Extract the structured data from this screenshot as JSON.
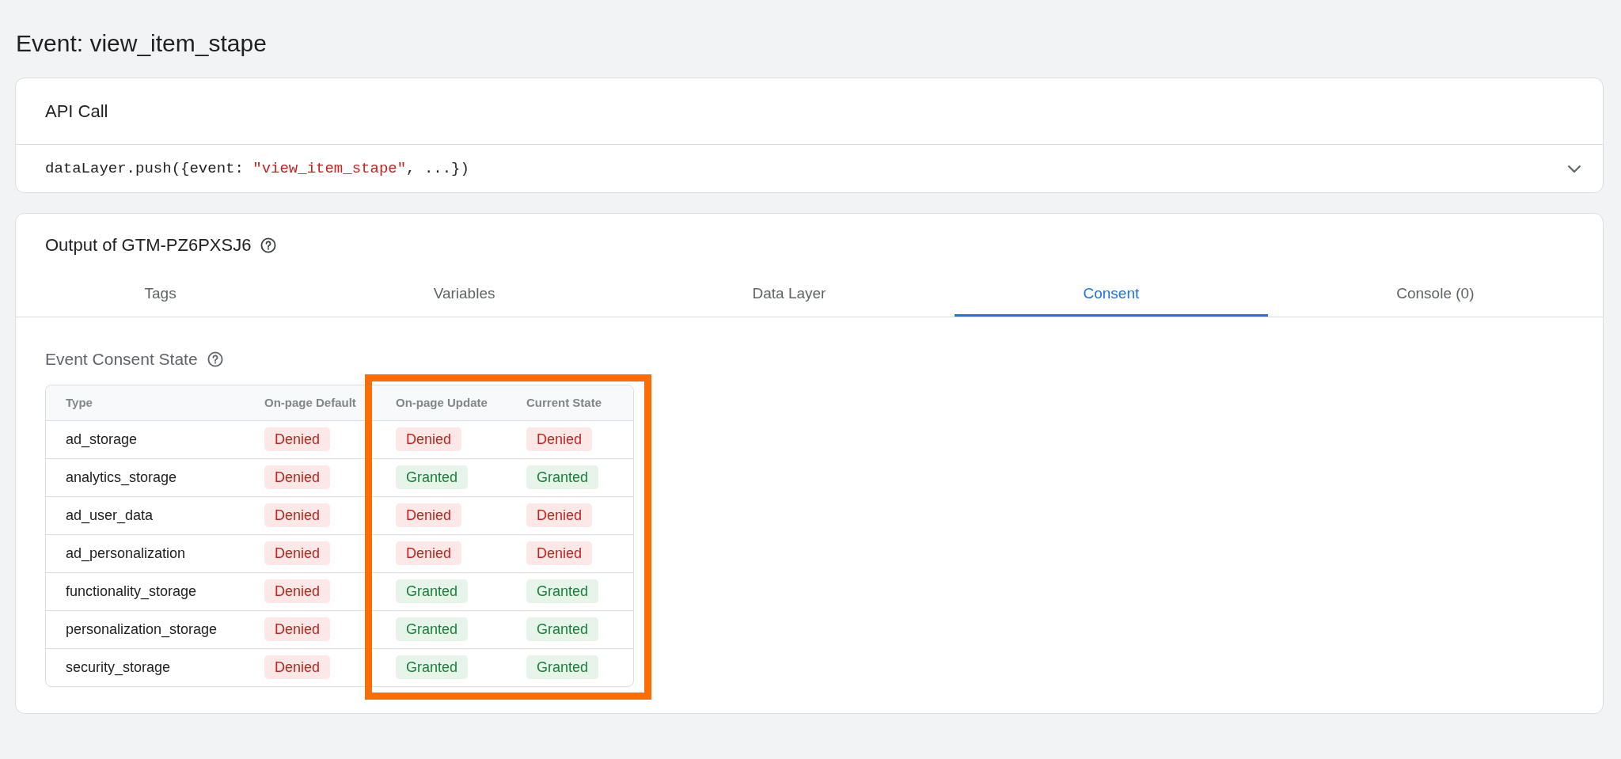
{
  "page_title": "Event: view_item_stape",
  "api_call": {
    "title": "API Call",
    "expanded": false,
    "code": [
      {
        "kind": "plain",
        "text": "dataLayer.push({event: "
      },
      {
        "kind": "string",
        "text": "\"view_item_stape\""
      },
      {
        "kind": "plain",
        "text": ", ...})"
      }
    ]
  },
  "output": {
    "title": "Output of GTM-PZ6PXSJ6",
    "tabs": [
      {
        "label": "Tags",
        "selected": false
      },
      {
        "label": "Variables",
        "selected": false
      },
      {
        "label": "Data Layer",
        "selected": false
      },
      {
        "label": "Consent",
        "selected": true
      },
      {
        "label": "Console (0)",
        "selected": false
      }
    ],
    "consent": {
      "heading": "Event Consent State",
      "columns": [
        {
          "label": "Type",
          "highlighted": false
        },
        {
          "label": "On-page Default",
          "highlighted": false
        },
        {
          "label": "On-page Update",
          "highlighted": true
        },
        {
          "label": "Current State",
          "highlighted": true
        }
      ],
      "rows": [
        {
          "type": "ad_storage",
          "values": [
            {
              "text": "Denied",
              "granted": false
            },
            {
              "text": "Denied",
              "granted": false
            },
            {
              "text": "Denied",
              "granted": false
            }
          ]
        },
        {
          "type": "analytics_storage",
          "values": [
            {
              "text": "Denied",
              "granted": false
            },
            {
              "text": "Granted",
              "granted": true
            },
            {
              "text": "Granted",
              "granted": true
            }
          ]
        },
        {
          "type": "ad_user_data",
          "values": [
            {
              "text": "Denied",
              "granted": false
            },
            {
              "text": "Denied",
              "granted": false
            },
            {
              "text": "Denied",
              "granted": false
            }
          ]
        },
        {
          "type": "ad_personalization",
          "values": [
            {
              "text": "Denied",
              "granted": false
            },
            {
              "text": "Denied",
              "granted": false
            },
            {
              "text": "Denied",
              "granted": false
            }
          ]
        },
        {
          "type": "functionality_storage",
          "values": [
            {
              "text": "Denied",
              "granted": false
            },
            {
              "text": "Granted",
              "granted": true
            },
            {
              "text": "Granted",
              "granted": true
            }
          ]
        },
        {
          "type": "personalization_storage",
          "values": [
            {
              "text": "Denied",
              "granted": false
            },
            {
              "text": "Granted",
              "granted": true
            },
            {
              "text": "Granted",
              "granted": true
            }
          ]
        },
        {
          "type": "security_storage",
          "values": [
            {
              "text": "Denied",
              "granted": false
            },
            {
              "text": "Granted",
              "granted": true
            },
            {
              "text": "Granted",
              "granted": true
            }
          ]
        }
      ]
    }
  }
}
